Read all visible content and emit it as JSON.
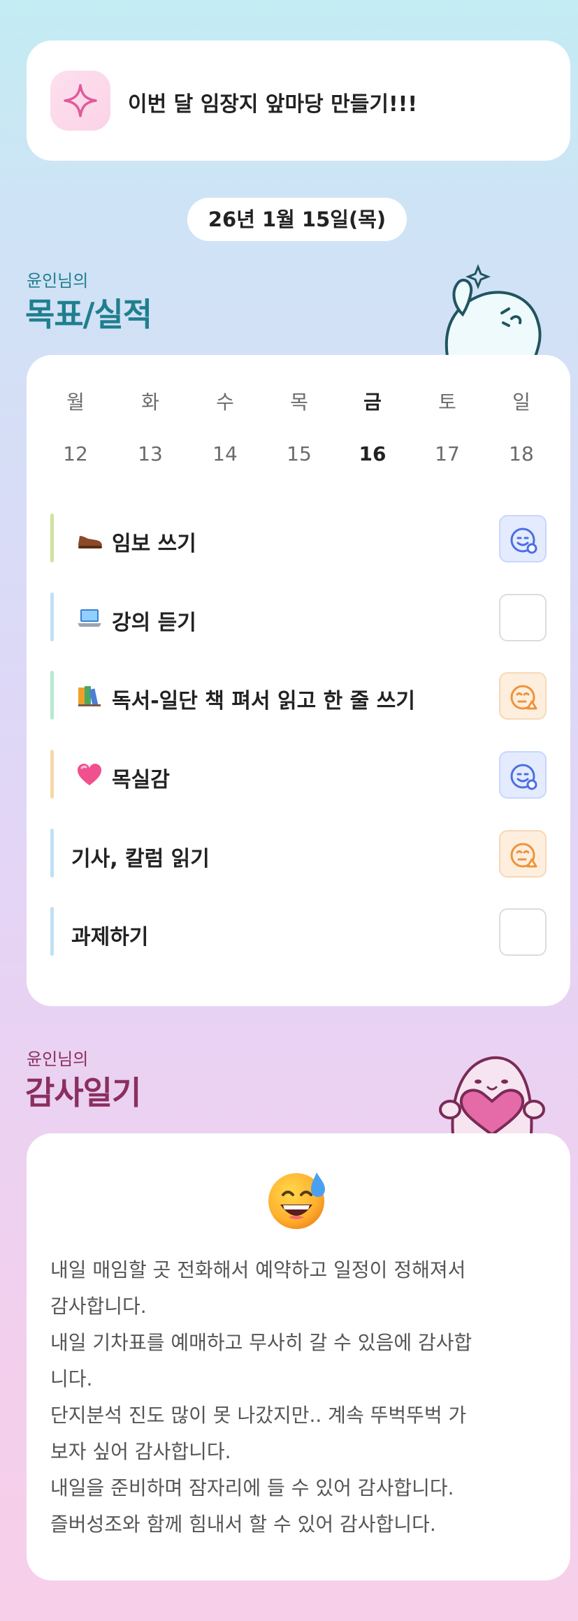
{
  "goal": {
    "text": "이번 달 임장지 앞마당 만들기!!!",
    "icon": "sparkle-icon"
  },
  "date": {
    "label": "26년 1월 15일(목)"
  },
  "goals_section": {
    "owner": "윤인님의",
    "title": "목표/실적"
  },
  "week": {
    "days": [
      {
        "name": "월",
        "num": "12"
      },
      {
        "name": "화",
        "num": "13"
      },
      {
        "name": "수",
        "num": "14"
      },
      {
        "name": "목",
        "num": "15"
      },
      {
        "name": "금",
        "num": "16"
      },
      {
        "name": "토",
        "num": "17"
      },
      {
        "name": "일",
        "num": "18"
      }
    ],
    "today_index": 4
  },
  "tasks": [
    {
      "emoji": "shoe-icon",
      "label": "임보 쓰기",
      "status": "blue",
      "bar_color": "#cfe39a"
    },
    {
      "emoji": "laptop-icon",
      "label": "강의 듣기",
      "status": "empty",
      "bar_color": "#bfe0f3"
    },
    {
      "emoji": "books-icon",
      "label": "독서-일단 책 펴서 읽고 한 줄 쓰기",
      "status": "orange",
      "bar_color": "#b8e8d2"
    },
    {
      "emoji": "heart-icon",
      "label": "목실감",
      "status": "blue",
      "bar_color": "#f5d9a8"
    },
    {
      "emoji": "",
      "label": "기사, 칼럼 읽기",
      "status": "orange",
      "bar_color": "#bfe0f3"
    },
    {
      "emoji": "",
      "label": "과제하기",
      "status": "empty",
      "bar_color": "#bfe0f3"
    }
  ],
  "gratitude_section": {
    "owner": "윤인님의",
    "title": "감사일기"
  },
  "gratitude": {
    "emoji": "grinning-sweat-face-icon",
    "lines": [
      "내일 매임할 곳 전화해서 예약하고 일정이 정해져서",
      "감사합니다.",
      "내일 기차표를 예매하고 무사히 갈 수 있음에 감사합",
      "니다.",
      "단지분석 진도 많이 못 나갔지만.. 계속 뚜벅뚜벅 가",
      "보자 싶어 감사합니다.",
      "내일을 준비하며 잠자리에 들 수 있어 감사합니다.",
      "즐버성조와 함께 힘내서 할 수 있어 감사합니다."
    ]
  },
  "colors": {
    "teal_title": "#1f7f8d",
    "plum_title": "#8a2f5e",
    "status_blue": "#4a6fe0",
    "status_orange": "#f0923a"
  }
}
